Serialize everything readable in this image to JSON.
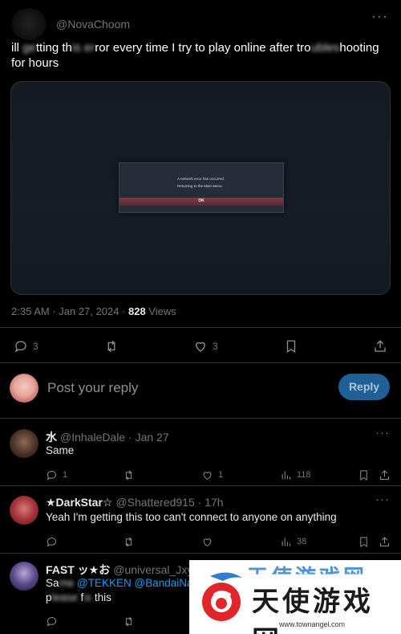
{
  "post": {
    "handle": "@NovaChoom",
    "more": "···",
    "text_line1_a": "ill ",
    "text_line1_blur1": "ge",
    "text_line1_b": "tting th",
    "text_line1_blur2": "is er",
    "text_line1_c": "ror every time I try to play online after tro",
    "text_line1_blur3": "ubles",
    "text_line1_d": "hooting",
    "text_line2": "for hours",
    "media": {
      "dialog_line1": "A network error has occurred.",
      "dialog_line2": "Returning to the Main Menu.",
      "ok_label": "OK"
    },
    "timestamp": "2:35 AM · Jan 27, 2024 · ",
    "views_count": "828",
    "views_label": " Views",
    "actions": {
      "replies": "3",
      "reposts": "",
      "likes": "3"
    }
  },
  "reply_box": {
    "placeholder": "Post your reply",
    "button_label": "Reply"
  },
  "replies": [
    {
      "name": "水",
      "handle": "@InhaleDale · Jan 27",
      "text": "Same",
      "replies": "1",
      "likes": "1",
      "views": "118"
    },
    {
      "name": "★DarkStar☆",
      "handle": "@Shattered915 · 17h",
      "text": "Yeah I'm getting this too can't connect to anyone on anything",
      "replies": "",
      "likes": "",
      "views": "38"
    },
    {
      "name": "FAST ッ★お",
      "handle": "@universal_Jxy · 2",
      "text_a": "Sa",
      "text_blur": "me",
      "mention1": "@TEKKEN",
      "mention2": "@BandaiNamc",
      "line2_a": "p",
      "line2_blur": "lease ",
      "line2_b": "f",
      "line2_blur2": "ix ",
      "line2_c": "this"
    }
  ],
  "watermark": {
    "title": "天使游戏网",
    "url": "www.townangel.com"
  },
  "colors": {
    "background": "#000000",
    "accent": "#1d9bf0",
    "reply_button": "#1f6096",
    "muted": "#71767b"
  }
}
